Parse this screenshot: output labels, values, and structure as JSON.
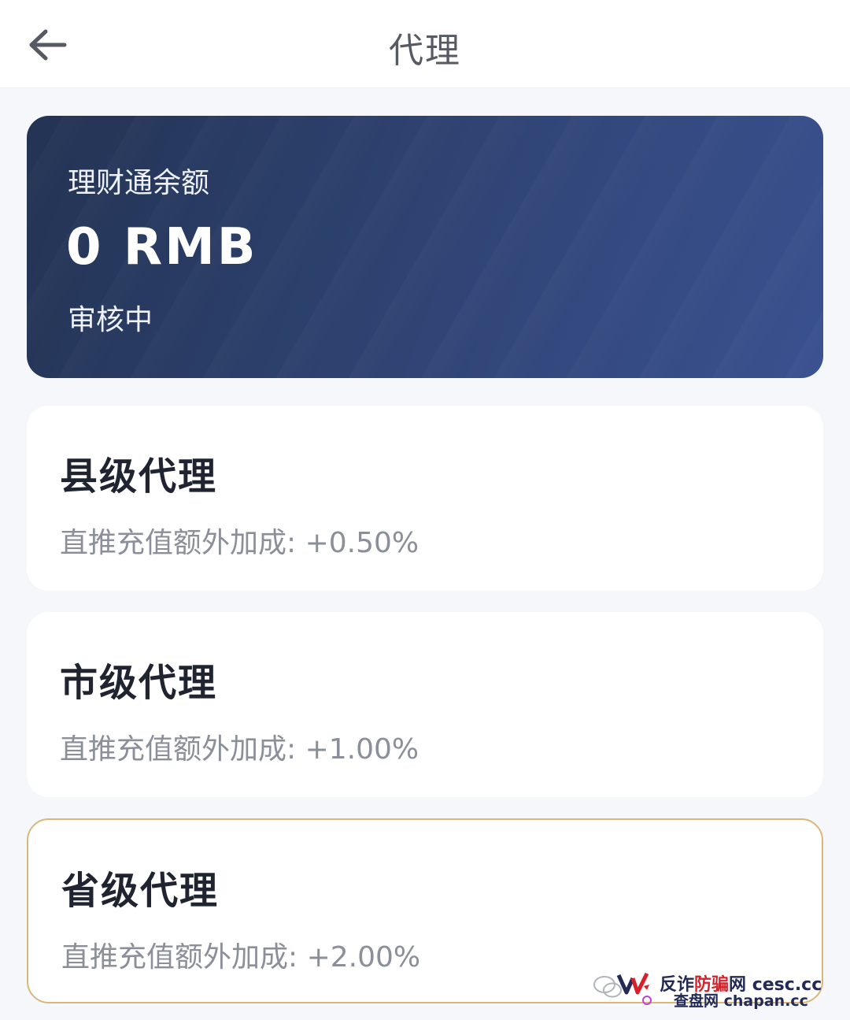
{
  "header": {
    "title": "代理"
  },
  "balance_card": {
    "label": "理财通余额",
    "amount": "0 RMB",
    "status": "审核中"
  },
  "tiers": [
    {
      "name": "县级代理",
      "bonus": "直推充值额外加成: +0.50%"
    },
    {
      "name": "市级代理",
      "bonus": "直推充值额外加成: +1.00%"
    },
    {
      "name": "省级代理",
      "bonus": "直推充值额外加成: +2.00%"
    }
  ],
  "watermark": {
    "line1_a": "反诈",
    "line1_b": "防骗",
    "line1_c": "网",
    "line1_d": "cesc.cc",
    "line2_a": "查盘网",
    "line2_b": "chapan.cc"
  },
  "colors": {
    "card_gradient_start": "#233353",
    "card_gradient_end": "#3a5190",
    "selected_border": "#d8b878",
    "page_background": "#f5f7fa"
  },
  "icons": {
    "back": "arrow-left-icon",
    "wechat": "wechat-icon"
  }
}
